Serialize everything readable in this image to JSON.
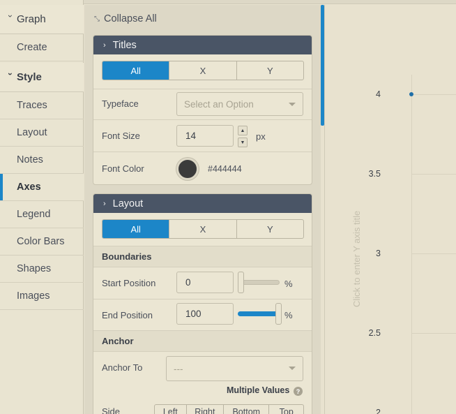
{
  "nav": {
    "graph": "Graph",
    "create": "Create",
    "style": "Style",
    "items": [
      "Traces",
      "Layout",
      "Notes",
      "Axes",
      "Legend",
      "Color Bars",
      "Shapes",
      "Images"
    ],
    "active": "Axes"
  },
  "panel": {
    "collapse_all": "Collapse All",
    "titles": {
      "header": "Titles",
      "tabs": [
        "All",
        "X",
        "Y"
      ],
      "typeface_label": "Typeface",
      "typeface_placeholder": "Select an Option",
      "font_size_label": "Font Size",
      "font_size_value": "14",
      "font_size_unit": "px",
      "font_color_label": "Font Color",
      "font_color_hex": "#444444"
    },
    "layout": {
      "header": "Layout",
      "tabs": [
        "All",
        "X",
        "Y"
      ],
      "boundaries_head": "Boundaries",
      "start_label": "Start Position",
      "start_value": "0",
      "start_fraction": 0,
      "end_label": "End Position",
      "end_value": "100",
      "end_fraction": 1,
      "percent": "%",
      "anchor_head": "Anchor",
      "anchor_to_label": "Anchor To",
      "anchor_to_value": "---",
      "multiple_values": "Multiple Values",
      "help_glyph": "?",
      "side_label": "Side",
      "side_options": [
        "Left",
        "Right",
        "Bottom",
        "Top"
      ]
    }
  },
  "plot": {
    "y_title_placeholder": "Click to enter Y axis title",
    "ticks": [
      "4",
      "3.5",
      "3",
      "2.5",
      "2"
    ]
  },
  "chart_data": {
    "type": "scatter",
    "x": [
      0
    ],
    "y": [
      4
    ],
    "yticks": [
      4,
      3.5,
      3,
      2.5,
      2
    ]
  },
  "colors": {
    "accent": "#1c86c8",
    "section_header": "#4a5566",
    "background": "#e8e2cf",
    "font_color_swatch": "#444444"
  }
}
